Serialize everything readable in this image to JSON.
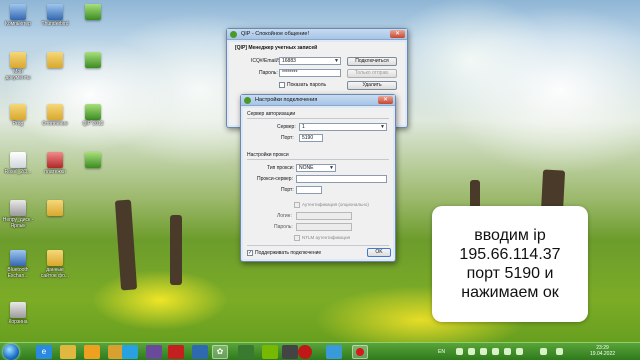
{
  "desktop": {
    "icons": [
      {
        "label": "Компьютер"
      },
      {
        "label": "Thunderbird"
      },
      {
        "label": ""
      },
      {
        "label": ""
      },
      {
        "label": "Мои документы"
      },
      {
        "label": ""
      },
      {
        "label": ""
      },
      {
        "label": ""
      },
      {
        "label": "Prog"
      },
      {
        "label": "Отопление"
      },
      {
        "label": "QIP 2012"
      },
      {
        "label": ""
      },
      {
        "label": "Rosel_2/3..."
      },
      {
        "label": "платежки"
      },
      {
        "label": ""
      },
      {
        "label": "Непру_диск - Ярлык"
      },
      {
        "label": ""
      },
      {
        "label": "Bluetooth Exchan..."
      },
      {
        "label": "данные сайтов фо..."
      },
      {
        "label": "Корзина"
      }
    ]
  },
  "qip_window": {
    "title": "QIP - Спокойное общение!",
    "section_title": "[QIP] Менеджер учетных записей",
    "login_label": "ICQ#/Email/SN:",
    "login_value": "16883",
    "password_label": "Пароль:",
    "password_value": "********",
    "connect_button": "Подключиться",
    "only_send_button": "Только отправ.",
    "delete_button": "Удалить",
    "show_password_label": "Показать пароль",
    "close_glyph": "✕"
  },
  "conn_dialog": {
    "title": "Настройки подключения",
    "auth_section": "Сервер авторизации",
    "server_label": "Сервер:",
    "server_value": "1",
    "port_label": "Порт:",
    "port_value": "5190",
    "proxy_section": "Настройки прокси",
    "proxy_type_label": "Тип прокси:",
    "proxy_type_value": "NONE",
    "proxy_server_label": "Прокси-сервер:",
    "proxy_port_label": "Порт:",
    "auth_optional_label": "Аутентификация (опционально)",
    "login_label": "Логин:",
    "password_label": "Пароль:",
    "ntlm_label": "NTLM аутентификация",
    "keepalive_label": "Поддерживать подключение",
    "keepalive_checked": "✓",
    "ok_button": "OK",
    "close_glyph": "✕"
  },
  "note": {
    "lines": [
      "вводим ip",
      "195.66.114.37",
      "порт 5190 и",
      "нажимаем ок"
    ]
  },
  "taskbar": {
    "lang": "EN",
    "time": "23:29",
    "date": "19.04.2022"
  }
}
